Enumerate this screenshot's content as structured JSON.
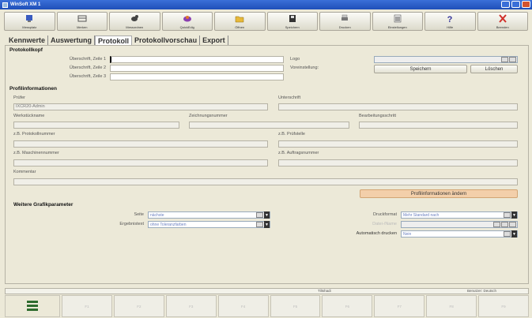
{
  "window": {
    "title": "WinSoft XM 1"
  },
  "toolbar": [
    {
      "label": "Messplatz",
      "icon": "measure-station-icon",
      "color": "#3a5cc0"
    },
    {
      "label": "Merken",
      "icon": "memory-icon",
      "color": "#555555"
    },
    {
      "label": "Messordnen",
      "icon": "dog-icon",
      "color": "#444444"
    },
    {
      "label": "QuickEdig",
      "icon": "quickedit-icon",
      "color": "#8a3fb0"
    },
    {
      "label": "Öffnen",
      "icon": "open-folder-icon",
      "color": "#b58a1a"
    },
    {
      "label": "Speichern",
      "icon": "save-disk-icon",
      "color": "#333333"
    },
    {
      "label": "Drucken",
      "icon": "print-icon",
      "color": "#555555"
    },
    {
      "label": "Einstellungen",
      "icon": "settings-list-icon",
      "color": "#555555"
    },
    {
      "label": "Hilfe",
      "icon": "help-icon",
      "color": "#333399"
    },
    {
      "label": "Beenden",
      "icon": "exit-x-icon",
      "color": "#d0302a"
    }
  ],
  "tabs": [
    {
      "label": "Kennwerte",
      "active": false
    },
    {
      "label": "Auswertung",
      "active": false
    },
    {
      "label": "Protokoll",
      "active": true
    },
    {
      "label": "Protokollvorschau",
      "active": false
    },
    {
      "label": "Export",
      "active": false
    }
  ],
  "protokollkopf": {
    "title": "Protokollkopf",
    "zeile1_label": "Überschrift, Zeile 1",
    "zeile2_label": "Überschrift, Zeile 2",
    "zeile3_label": "Überschrift, Zeile 3",
    "logo_label": "Logo",
    "voreinstellung_label": "Voreinstellung:",
    "speichern_label": "Speichern",
    "loeschen_label": "Löschen"
  },
  "profilinfo": {
    "title": "Profilinformationen",
    "pruefer_label": "Prüfer",
    "pruefer_value": "IXCR20-Admin",
    "unterschrift_label": "Unterschrift",
    "werkstueck_label": "Werkstückname",
    "zeichnung_label": "Zeichnungsnummer",
    "bearbeitung_label": "Bearbeitungsschritt",
    "protokoll_label": "z.B. Protokollnummer",
    "pruefstelle_label": "z.B. Prüfstelle",
    "maschine_label": "z.B. Maschinennummer",
    "auftrag_label": "z.B. Auftragsnummer",
    "kommentar_label": "Kommentar",
    "aendern_label": "Profilinformationen ändern"
  },
  "grafik": {
    "title": "Weitere Grafikparameter",
    "seite_label": "Seite",
    "seite_value": "nächste",
    "ergebnistext_label": "Ergebnistext",
    "ergebnistext_value": "ohne Toleranzfarben",
    "druckformat_label": "Druckformat",
    "druckformat_value": "Mehr Standard nach",
    "dateiname_label": "Datei-/Name",
    "auto_druck_label": "Automatisch drucken",
    "auto_druck_value": "Nein"
  },
  "status": {
    "left": "Tiltshadi",
    "right": "Benutzer: Deutsch"
  },
  "fkeys": [
    "F1",
    "F2",
    "F3",
    "F4",
    "F5",
    "F6",
    "F7",
    "F8",
    "F9"
  ]
}
